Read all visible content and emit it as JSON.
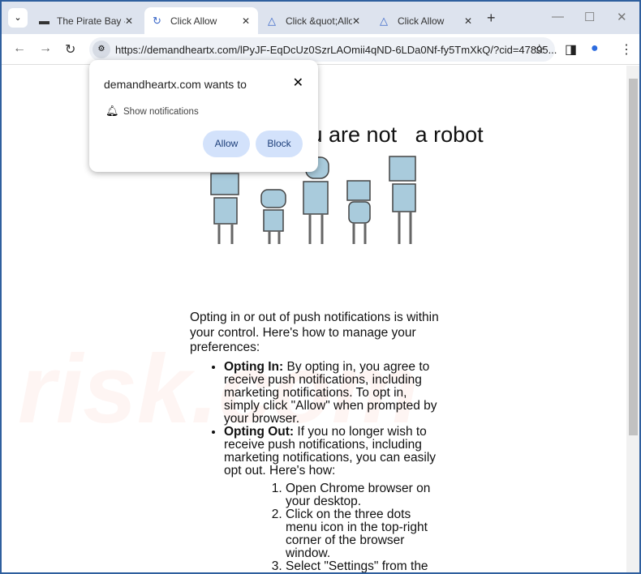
{
  "tabs": [
    {
      "title": "The Pirate Bay -",
      "icon": "pirate-ship-icon"
    },
    {
      "title": "Click Allow",
      "icon": "loading-icon",
      "active": true
    },
    {
      "title": "Click &quot;Allo",
      "icon": "bell-icon"
    },
    {
      "title": "Click Allow",
      "icon": "bell-icon"
    }
  ],
  "address": {
    "url": "https://demandheartx.com/lPyJF-EqDcUz0SzrLAOmii4qND-6LDa0Nf-fy5TmXkQ/?cid=47895..."
  },
  "popup": {
    "title": "demandheartx.com wants to",
    "permission": "Show notifications",
    "allow": "Allow",
    "block": "Block"
  },
  "page": {
    "heading": "you are not   a robot",
    "intro": "Opting in or out of push notifications is within your control. Here's how to manage your preferences:",
    "items": [
      {
        "bold": "Opting In:",
        "text": " By opting in, you agree to receive push notifications, including marketing notifications. To opt in, simply click \"Allow\" when prompted by your browser."
      },
      {
        "bold": "Opting Out:",
        "text": " If you no longer wish to receive push notifications, including marketing notifications, you can easily opt out. Here's how:"
      }
    ],
    "steps": [
      "Open Chrome browser on your desktop.",
      "Click on the three dots menu icon in the top-right corner of the browser window.",
      "Select \"Settings\" from the dropdown menu."
    ]
  },
  "watermark": "risk.com"
}
